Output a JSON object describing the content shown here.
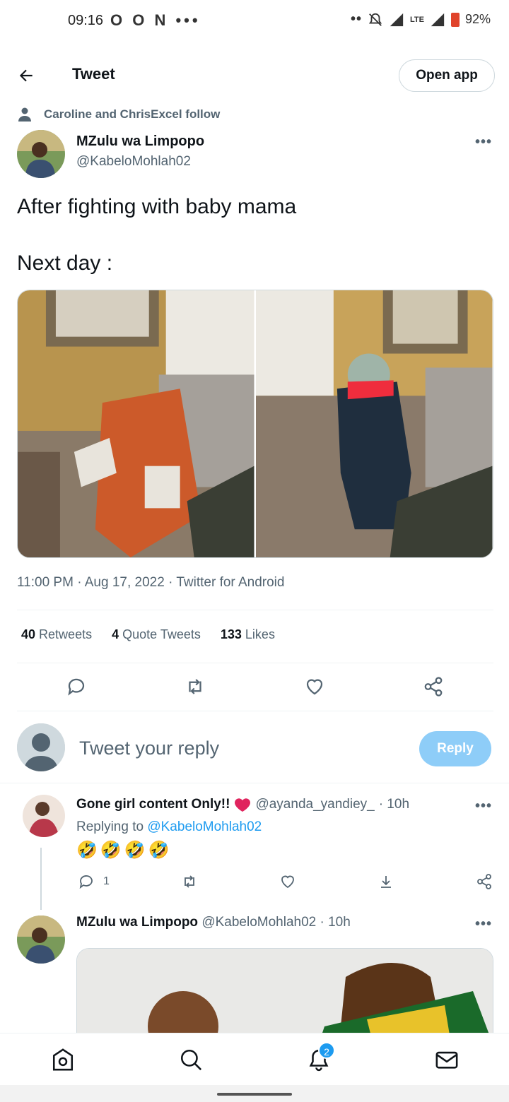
{
  "status_bar": {
    "time": "09:16",
    "left_icons": "O O N •••",
    "dots": "••",
    "network": "LTE",
    "battery": "92%"
  },
  "header": {
    "title": "Tweet",
    "open_app": "Open app"
  },
  "social_context": "Caroline and ChrisExcel follow",
  "tweet": {
    "author_name": "MZulu wa Limpopo",
    "author_handle": "@KabeloMohlah02",
    "text_line1": "After fighting with baby mama",
    "text_line2": "Next day :",
    "timestamp": "11:00 PM · Aug 17, 2022 · Twitter for Android",
    "stats": {
      "retweets_count": "40",
      "retweets_label": "Retweets",
      "quotes_count": "4",
      "quotes_label": "Quote Tweets",
      "likes_count": "133",
      "likes_label": "Likes"
    }
  },
  "reply_box": {
    "placeholder": "Tweet your reply",
    "button": "Reply"
  },
  "replies": [
    {
      "name": "Gone girl content Only!!",
      "handle": "@ayanda_yandiey_",
      "time": "· 10h",
      "replying_prefix": "Replying to",
      "replying_to": "@KabeloMohlah02",
      "text": "🤣🤣🤣🤣",
      "reply_count": "1"
    },
    {
      "name": "MZulu wa Limpopo",
      "handle": "@KabeloMohlah02",
      "time": "· 10h"
    }
  ],
  "bottom_nav": {
    "notifications_badge": "2"
  },
  "colors": {
    "accent": "#1d9bf0",
    "reply_button_disabled": "#8ecdf8",
    "secondary_text": "#536471",
    "heart_red": "#e0245e"
  }
}
